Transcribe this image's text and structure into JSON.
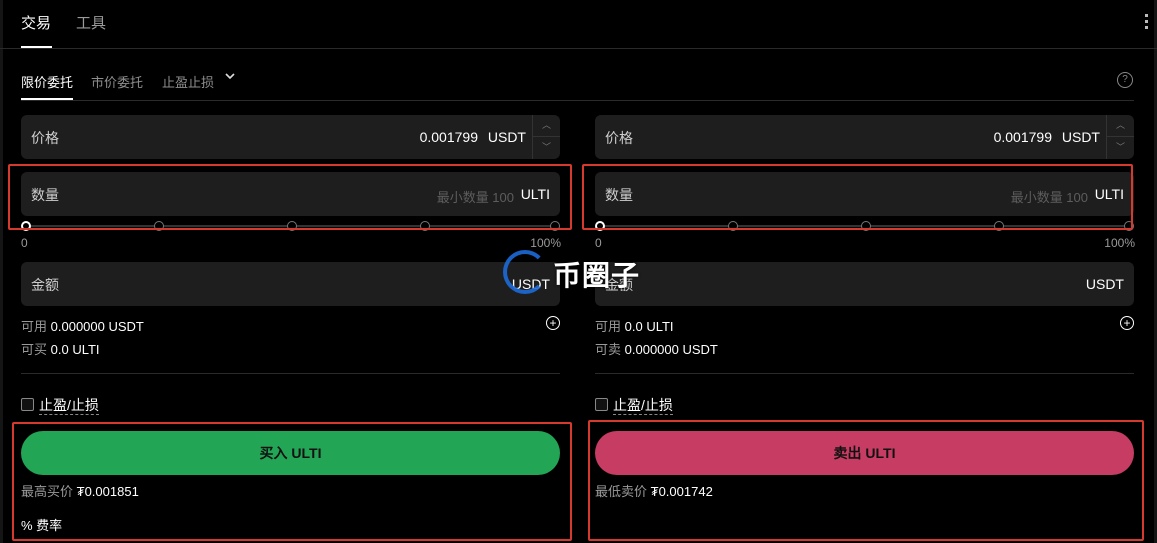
{
  "header": {
    "tabs": [
      "交易",
      "工具"
    ]
  },
  "order_tabs": {
    "limit": "限价委托",
    "market": "市价委托",
    "stop": "止盈止损",
    "chevron": "chevron-down-icon",
    "help": "?"
  },
  "buy": {
    "price_label": "价格",
    "price_value": "0.001799",
    "price_unit": "USDT",
    "qty_label": "数量",
    "qty_placeholder": "最小数量 100",
    "qty_unit": "ULTI",
    "slider_min": "0",
    "slider_max": "100%",
    "slider_value_fraction": 0,
    "amount_label": "金额",
    "amount_unit": "USDT",
    "avail_label": "可用",
    "avail_value": "0.000000 USDT",
    "canbuy_label": "可买",
    "canbuy_value": "0.0 ULTI",
    "tpsl_label": "止盈/止损",
    "action_label": "买入 ULTI",
    "best_label": "最高买价",
    "best_value": "₮0.001851",
    "fee_label": "% 费率"
  },
  "sell": {
    "price_label": "价格",
    "price_value": "0.001799",
    "price_unit": "USDT",
    "qty_label": "数量",
    "qty_placeholder": "最小数量 100",
    "qty_unit": "ULTI",
    "slider_min": "0",
    "slider_max": "100%",
    "slider_value_fraction": 0,
    "amount_label": "金额",
    "amount_unit": "USDT",
    "avail_label": "可用",
    "avail_value": "0.0 ULTI",
    "cansell_label": "可卖",
    "cansell_value": "0.000000 USDT",
    "tpsl_label": "止盈/止损",
    "action_label": "卖出 ULTI",
    "best_label": "最低卖价",
    "best_value": "₮0.001742"
  },
  "watermark": {
    "text": "币圈子"
  },
  "colors": {
    "buy": "#22a555",
    "sell": "#c73c63",
    "highlight": "#d63a2f"
  }
}
